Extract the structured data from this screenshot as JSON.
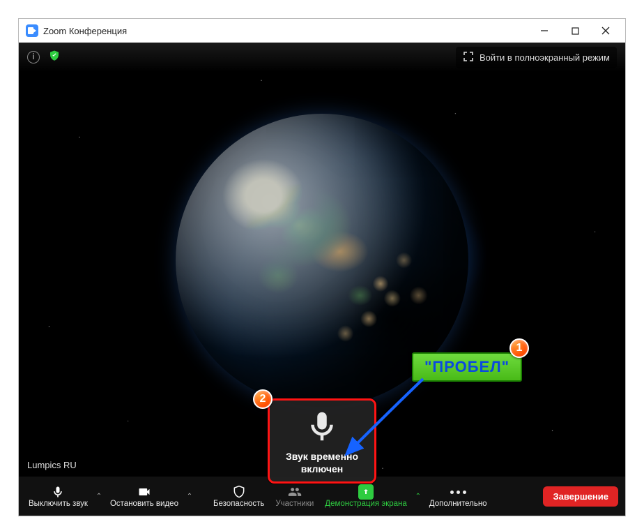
{
  "window": {
    "title": "Zoom Конференция"
  },
  "topbar": {
    "fullscreen_label": "Войти в полноэкранный режим"
  },
  "participant_name": "Lumpics RU",
  "toolbar": {
    "mute": "Выключить звук",
    "video": "Остановить видео",
    "security": "Безопасность",
    "participants": "Участники",
    "share": "Демонстрация экрана",
    "more": "Дополнительно",
    "end": "Завершение"
  },
  "mic_popup": {
    "text": "Звук временно включен"
  },
  "annotations": {
    "probel": "\"ПРОБЕЛ\"",
    "one": "1",
    "two": "2"
  }
}
